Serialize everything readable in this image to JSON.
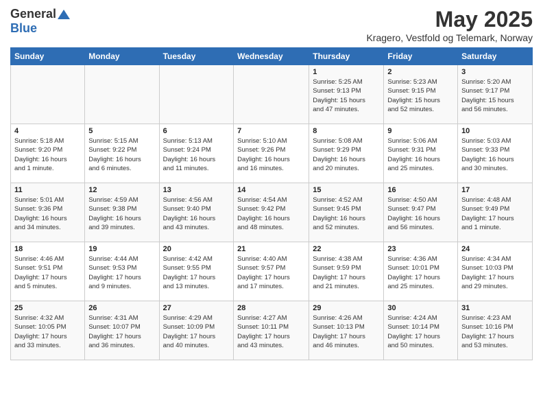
{
  "header": {
    "logo_general": "General",
    "logo_blue": "Blue",
    "month_year": "May 2025",
    "location": "Kragero, Vestfold og Telemark, Norway"
  },
  "calendar": {
    "days_of_week": [
      "Sunday",
      "Monday",
      "Tuesday",
      "Wednesday",
      "Thursday",
      "Friday",
      "Saturday"
    ],
    "weeks": [
      [
        {
          "day": "",
          "info": ""
        },
        {
          "day": "",
          "info": ""
        },
        {
          "day": "",
          "info": ""
        },
        {
          "day": "",
          "info": ""
        },
        {
          "day": "1",
          "info": "Sunrise: 5:25 AM\nSunset: 9:13 PM\nDaylight: 15 hours\nand 47 minutes."
        },
        {
          "day": "2",
          "info": "Sunrise: 5:23 AM\nSunset: 9:15 PM\nDaylight: 15 hours\nand 52 minutes."
        },
        {
          "day": "3",
          "info": "Sunrise: 5:20 AM\nSunset: 9:17 PM\nDaylight: 15 hours\nand 56 minutes."
        }
      ],
      [
        {
          "day": "4",
          "info": "Sunrise: 5:18 AM\nSunset: 9:20 PM\nDaylight: 16 hours\nand 1 minute."
        },
        {
          "day": "5",
          "info": "Sunrise: 5:15 AM\nSunset: 9:22 PM\nDaylight: 16 hours\nand 6 minutes."
        },
        {
          "day": "6",
          "info": "Sunrise: 5:13 AM\nSunset: 9:24 PM\nDaylight: 16 hours\nand 11 minutes."
        },
        {
          "day": "7",
          "info": "Sunrise: 5:10 AM\nSunset: 9:26 PM\nDaylight: 16 hours\nand 16 minutes."
        },
        {
          "day": "8",
          "info": "Sunrise: 5:08 AM\nSunset: 9:29 PM\nDaylight: 16 hours\nand 20 minutes."
        },
        {
          "day": "9",
          "info": "Sunrise: 5:06 AM\nSunset: 9:31 PM\nDaylight: 16 hours\nand 25 minutes."
        },
        {
          "day": "10",
          "info": "Sunrise: 5:03 AM\nSunset: 9:33 PM\nDaylight: 16 hours\nand 30 minutes."
        }
      ],
      [
        {
          "day": "11",
          "info": "Sunrise: 5:01 AM\nSunset: 9:36 PM\nDaylight: 16 hours\nand 34 minutes."
        },
        {
          "day": "12",
          "info": "Sunrise: 4:59 AM\nSunset: 9:38 PM\nDaylight: 16 hours\nand 39 minutes."
        },
        {
          "day": "13",
          "info": "Sunrise: 4:56 AM\nSunset: 9:40 PM\nDaylight: 16 hours\nand 43 minutes."
        },
        {
          "day": "14",
          "info": "Sunrise: 4:54 AM\nSunset: 9:42 PM\nDaylight: 16 hours\nand 48 minutes."
        },
        {
          "day": "15",
          "info": "Sunrise: 4:52 AM\nSunset: 9:45 PM\nDaylight: 16 hours\nand 52 minutes."
        },
        {
          "day": "16",
          "info": "Sunrise: 4:50 AM\nSunset: 9:47 PM\nDaylight: 16 hours\nand 56 minutes."
        },
        {
          "day": "17",
          "info": "Sunrise: 4:48 AM\nSunset: 9:49 PM\nDaylight: 17 hours\nand 1 minute."
        }
      ],
      [
        {
          "day": "18",
          "info": "Sunrise: 4:46 AM\nSunset: 9:51 PM\nDaylight: 17 hours\nand 5 minutes."
        },
        {
          "day": "19",
          "info": "Sunrise: 4:44 AM\nSunset: 9:53 PM\nDaylight: 17 hours\nand 9 minutes."
        },
        {
          "day": "20",
          "info": "Sunrise: 4:42 AM\nSunset: 9:55 PM\nDaylight: 17 hours\nand 13 minutes."
        },
        {
          "day": "21",
          "info": "Sunrise: 4:40 AM\nSunset: 9:57 PM\nDaylight: 17 hours\nand 17 minutes."
        },
        {
          "day": "22",
          "info": "Sunrise: 4:38 AM\nSunset: 9:59 PM\nDaylight: 17 hours\nand 21 minutes."
        },
        {
          "day": "23",
          "info": "Sunrise: 4:36 AM\nSunset: 10:01 PM\nDaylight: 17 hours\nand 25 minutes."
        },
        {
          "day": "24",
          "info": "Sunrise: 4:34 AM\nSunset: 10:03 PM\nDaylight: 17 hours\nand 29 minutes."
        }
      ],
      [
        {
          "day": "25",
          "info": "Sunrise: 4:32 AM\nSunset: 10:05 PM\nDaylight: 17 hours\nand 33 minutes."
        },
        {
          "day": "26",
          "info": "Sunrise: 4:31 AM\nSunset: 10:07 PM\nDaylight: 17 hours\nand 36 minutes."
        },
        {
          "day": "27",
          "info": "Sunrise: 4:29 AM\nSunset: 10:09 PM\nDaylight: 17 hours\nand 40 minutes."
        },
        {
          "day": "28",
          "info": "Sunrise: 4:27 AM\nSunset: 10:11 PM\nDaylight: 17 hours\nand 43 minutes."
        },
        {
          "day": "29",
          "info": "Sunrise: 4:26 AM\nSunset: 10:13 PM\nDaylight: 17 hours\nand 46 minutes."
        },
        {
          "day": "30",
          "info": "Sunrise: 4:24 AM\nSunset: 10:14 PM\nDaylight: 17 hours\nand 50 minutes."
        },
        {
          "day": "31",
          "info": "Sunrise: 4:23 AM\nSunset: 10:16 PM\nDaylight: 17 hours\nand 53 minutes."
        }
      ]
    ]
  }
}
